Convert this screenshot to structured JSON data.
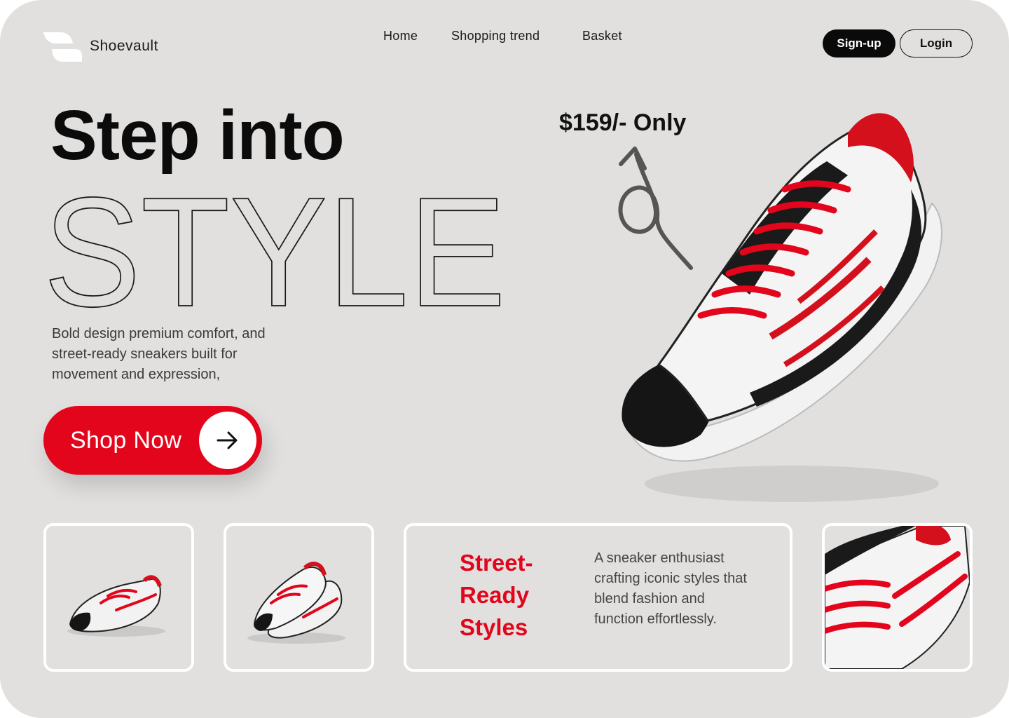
{
  "brand": {
    "name": "Shoevault",
    "logo_icon": "leaf-logo-icon"
  },
  "nav": {
    "items": [
      "Home",
      "Shopping trend",
      "Basket"
    ]
  },
  "auth": {
    "signup_label": "Sign-up",
    "login_label": "Login"
  },
  "hero": {
    "line1": "Step into",
    "line2": "STYLE",
    "description": "Bold design premium comfort, and street-ready sneakers built for movement and expression,",
    "cta_label": "Shop Now",
    "cta_icon": "arrow-right-icon",
    "price": "$159/- Only"
  },
  "feature": {
    "title_lines": [
      "Street-",
      "Ready",
      "Styles"
    ],
    "text": "A sneaker enthusiast crafting iconic styles that blend fashion and function effortlessly."
  },
  "colors": {
    "accent": "#e3051b",
    "background": "#e1e0df",
    "dark": "#0a0a0a",
    "card_border": "#ffffff"
  }
}
